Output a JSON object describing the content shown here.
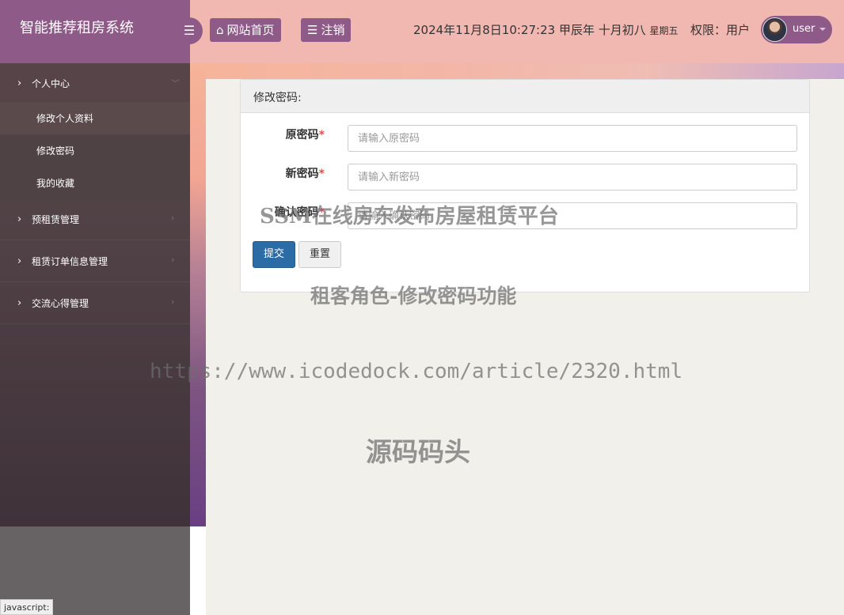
{
  "brand": {
    "title": "智能推荐租房系统"
  },
  "header": {
    "home_label": "网站首页",
    "logout_label": "注销",
    "datetime": "2024年11月8日10:27:23 甲辰年 十月初八",
    "weekday": "星期五",
    "permission": "权限：用户",
    "username": "user"
  },
  "sidebar": {
    "groups": [
      {
        "label": "个人中心",
        "expanded": true,
        "items": [
          {
            "label": "修改个人资料"
          },
          {
            "label": "修改密码"
          },
          {
            "label": "我的收藏"
          }
        ]
      },
      {
        "label": "预租赁管理"
      },
      {
        "label": "租赁订单信息管理"
      },
      {
        "label": "交流心得管理"
      }
    ]
  },
  "panel": {
    "title": "修改密码:",
    "fields": [
      {
        "label": "原密码",
        "required_mark": "*",
        "placeholder": "请输入原密码"
      },
      {
        "label": "新密码",
        "required_mark": "*",
        "placeholder": "请输入新密码"
      },
      {
        "label": "确认密码",
        "required_mark": "*",
        "placeholder": "请输入确认密码"
      }
    ],
    "submit_label": "提交",
    "reset_label": "重置"
  },
  "watermarks": {
    "line1": "SSM在线房东发布房屋租赁平台",
    "line2": "租客角色-修改密码功能",
    "line3": "https://www.icodedock.com/article/2320.html",
    "line4": "源码码头"
  },
  "status_bar": {
    "text": "javascript:"
  },
  "colors": {
    "brand_purple": "#8e5a88",
    "topbar_pink": "#f1b8b1",
    "primary_button": "#2c6ca6",
    "required": "#d9534f"
  }
}
